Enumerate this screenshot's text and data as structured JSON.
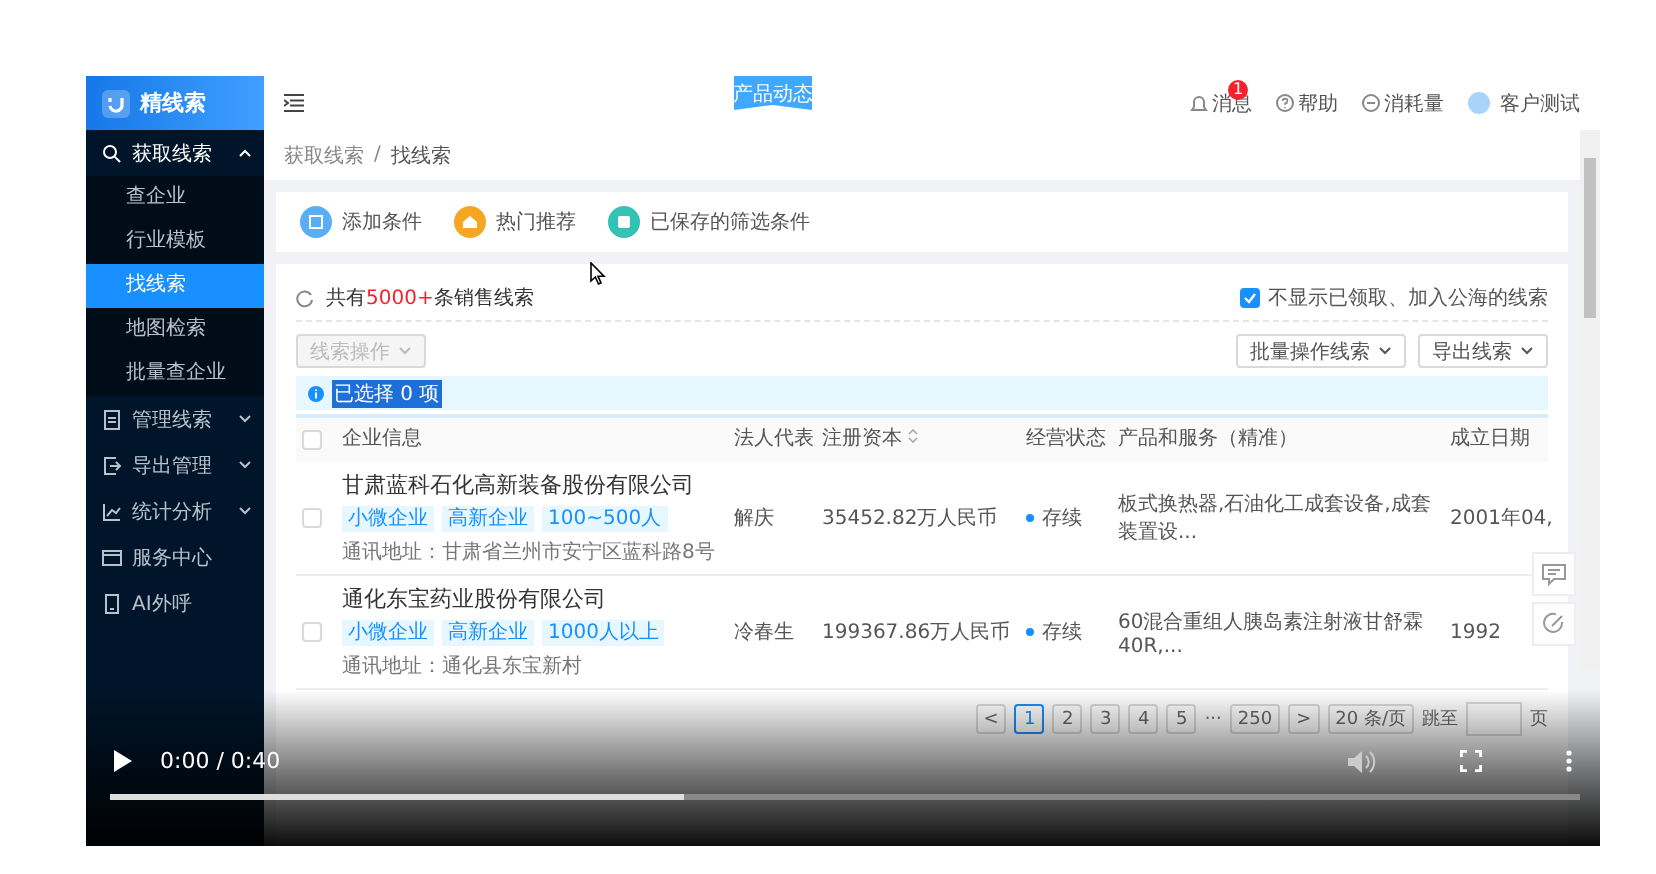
{
  "sidebar": {
    "logo": "精线索",
    "menu": [
      {
        "label": "获取线索",
        "kind": "group",
        "expanded": true,
        "children": [
          {
            "label": "查企业",
            "selected": false
          },
          {
            "label": "行业模板",
            "selected": false
          },
          {
            "label": "找线索",
            "selected": true
          },
          {
            "label": "地图检索",
            "selected": false
          },
          {
            "label": "批量查企业",
            "selected": false
          }
        ]
      },
      {
        "label": "管理线索",
        "kind": "group",
        "expanded": false
      },
      {
        "label": "导出管理",
        "kind": "group",
        "expanded": false
      },
      {
        "label": "统计分析",
        "kind": "group",
        "expanded": false
      },
      {
        "label": "服务中心",
        "kind": "link"
      },
      {
        "label": "AI外呼",
        "kind": "link"
      }
    ]
  },
  "header": {
    "ribbon": "产品动态",
    "notifications": {
      "label": "消息",
      "badge": "1"
    },
    "help": "帮助",
    "usage": "消耗量",
    "user": "客户测试"
  },
  "breadcrumb": {
    "items": [
      "获取线索",
      "找线索"
    ],
    "separator": "/"
  },
  "filters": [
    "添加条件",
    "热门推荐",
    "已保存的筛选条件"
  ],
  "list": {
    "total_prefix": "共有",
    "total_count": "5000+",
    "total_suffix": "条销售线索",
    "hide_claimed": {
      "label": "不显示已领取、加入公海的线索",
      "checked": true
    },
    "lead_actions": {
      "label": "线索操作",
      "disabled": true
    },
    "batch_actions": "批量操作线索",
    "export": "导出线索",
    "selected_info": "已选择 0 项",
    "select_all": {
      "checked": false
    },
    "columns": [
      {
        "label": "企业信息",
        "sortable": false
      },
      {
        "label": "法人代表",
        "sortable": false
      },
      {
        "label": "注册资本",
        "sortable": true
      },
      {
        "label": "经营状态",
        "sortable": false
      },
      {
        "label": "产品和服务（精准）",
        "sortable": false
      },
      {
        "label": "成立日期",
        "sortable": false
      }
    ],
    "rows": [
      {
        "checked": false,
        "name": "甘肃蓝科石化高新装备股份有限公司",
        "tags": [
          "小微企业",
          "高新企业",
          "100~500人"
        ],
        "address": "通讯地址：甘肃省兰州市安宁区蓝科路8号",
        "legal_rep": "解庆",
        "capital": "35452.82万人民币",
        "status": "存续",
        "products": "板式换热器,石油化工成套设备,成套装置设...",
        "founded": "2001年04,"
      },
      {
        "checked": false,
        "name": "通化东宝药业股份有限公司",
        "tags": [
          "小微企业",
          "高新企业",
          "1000人以上"
        ],
        "address": "通讯地址：通化县东宝新村",
        "legal_rep": "冷春生",
        "capital": "199367.86万人民币",
        "status": "存续",
        "products": "60混合重组人胰岛素注射液甘舒霖40R,...",
        "founded": "1992"
      }
    ],
    "pagination": {
      "prev": "<",
      "pages": [
        {
          "label": "1",
          "selected": true
        },
        {
          "label": "2",
          "selected": false
        },
        {
          "label": "3",
          "selected": false
        },
        {
          "label": "4",
          "selected": false
        },
        {
          "label": "5",
          "selected": false
        }
      ],
      "ellipsis": "···",
      "last": "250",
      "next": ">",
      "page_size": "20 条/页",
      "jump_label": "跳至",
      "jump_suffix": "页"
    }
  },
  "video": {
    "time": "0:00 / 0:40",
    "progress": {
      "level": 0.39
    }
  }
}
